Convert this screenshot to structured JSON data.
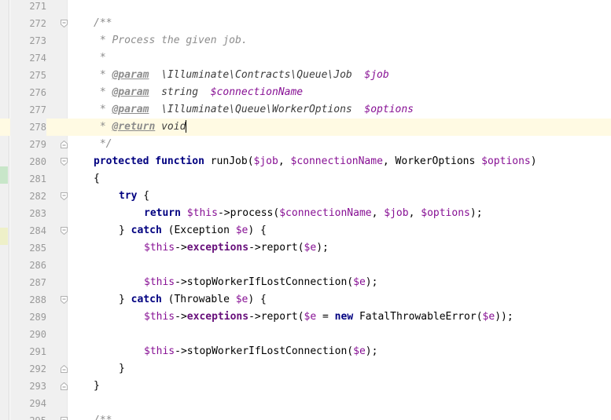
{
  "editor": {
    "current_line": 278,
    "lines": [
      {
        "n": "271",
        "indent": 1,
        "fold": "",
        "tokens": []
      },
      {
        "n": "272",
        "indent": 1,
        "fold": "open",
        "tokens": [
          {
            "t": "/**",
            "c": "doc"
          }
        ]
      },
      {
        "n": "273",
        "indent": 1,
        "fold": "",
        "tokens": [
          {
            "t": " * Process the given job.",
            "c": "doc"
          }
        ]
      },
      {
        "n": "274",
        "indent": 1,
        "fold": "",
        "tokens": [
          {
            "t": " *",
            "c": "doc"
          }
        ]
      },
      {
        "n": "275",
        "indent": 1,
        "fold": "",
        "tokens": [
          {
            "t": " * ",
            "c": "doc"
          },
          {
            "t": "@param",
            "c": "tag"
          },
          {
            "t": "  \\Illuminate\\Contracts\\Queue\\Job  ",
            "c": "dtype"
          },
          {
            "t": "$job",
            "c": "dvar"
          }
        ]
      },
      {
        "n": "276",
        "indent": 1,
        "fold": "",
        "tokens": [
          {
            "t": " * ",
            "c": "doc"
          },
          {
            "t": "@param",
            "c": "tag"
          },
          {
            "t": "  string  ",
            "c": "dtype"
          },
          {
            "t": "$connectionName",
            "c": "dvar"
          }
        ]
      },
      {
        "n": "277",
        "indent": 1,
        "fold": "",
        "tokens": [
          {
            "t": " * ",
            "c": "doc"
          },
          {
            "t": "@param",
            "c": "tag"
          },
          {
            "t": "  \\Illuminate\\Queue\\WorkerOptions  ",
            "c": "dtype"
          },
          {
            "t": "$options",
            "c": "dvar"
          }
        ]
      },
      {
        "n": "278",
        "indent": 1,
        "fold": "",
        "caret": true,
        "tokens": [
          {
            "t": " * ",
            "c": "doc"
          },
          {
            "t": "@return",
            "c": "tag"
          },
          {
            "t": " void",
            "c": "dtype"
          }
        ]
      },
      {
        "n": "279",
        "indent": 1,
        "fold": "close",
        "tokens": [
          {
            "t": " */",
            "c": "doc"
          }
        ]
      },
      {
        "n": "280",
        "indent": 1,
        "fold": "open",
        "tokens": [
          {
            "t": "protected",
            "c": "kw"
          },
          {
            "t": " ",
            "c": "plain"
          },
          {
            "t": "function",
            "c": "kw"
          },
          {
            "t": " runJob(",
            "c": "plain"
          },
          {
            "t": "$job",
            "c": "var"
          },
          {
            "t": ", ",
            "c": "plain"
          },
          {
            "t": "$connectionName",
            "c": "var"
          },
          {
            "t": ", WorkerOptions ",
            "c": "plain"
          },
          {
            "t": "$options",
            "c": "var"
          },
          {
            "t": ")",
            "c": "plain"
          }
        ]
      },
      {
        "n": "281",
        "indent": 1,
        "fold": "",
        "tokens": [
          {
            "t": "{",
            "c": "plain"
          }
        ]
      },
      {
        "n": "282",
        "indent": 2,
        "fold": "open",
        "tokens": [
          {
            "t": "try",
            "c": "kw"
          },
          {
            "t": " {",
            "c": "plain"
          }
        ]
      },
      {
        "n": "283",
        "indent": 3,
        "fold": "",
        "tokens": [
          {
            "t": "return",
            "c": "kw"
          },
          {
            "t": " ",
            "c": "plain"
          },
          {
            "t": "$this",
            "c": "var"
          },
          {
            "t": "->process(",
            "c": "plain"
          },
          {
            "t": "$connectionName",
            "c": "var"
          },
          {
            "t": ", ",
            "c": "plain"
          },
          {
            "t": "$job",
            "c": "var"
          },
          {
            "t": ", ",
            "c": "plain"
          },
          {
            "t": "$options",
            "c": "var"
          },
          {
            "t": ");",
            "c": "plain"
          }
        ]
      },
      {
        "n": "284",
        "indent": 2,
        "fold": "open",
        "tokens": [
          {
            "t": "} ",
            "c": "plain"
          },
          {
            "t": "catch",
            "c": "kw"
          },
          {
            "t": " (Exception ",
            "c": "plain"
          },
          {
            "t": "$e",
            "c": "var"
          },
          {
            "t": ") {",
            "c": "plain"
          }
        ]
      },
      {
        "n": "285",
        "indent": 3,
        "fold": "",
        "tokens": [
          {
            "t": "$this",
            "c": "var"
          },
          {
            "t": "->",
            "c": "plain"
          },
          {
            "t": "exceptions",
            "c": "prop"
          },
          {
            "t": "->report(",
            "c": "plain"
          },
          {
            "t": "$e",
            "c": "var"
          },
          {
            "t": ");",
            "c": "plain"
          }
        ]
      },
      {
        "n": "286",
        "indent": 3,
        "fold": "",
        "tokens": []
      },
      {
        "n": "287",
        "indent": 3,
        "fold": "",
        "tokens": [
          {
            "t": "$this",
            "c": "var"
          },
          {
            "t": "->stopWorkerIfLostConnection(",
            "c": "plain"
          },
          {
            "t": "$e",
            "c": "var"
          },
          {
            "t": ");",
            "c": "plain"
          }
        ]
      },
      {
        "n": "288",
        "indent": 2,
        "fold": "open",
        "tokens": [
          {
            "t": "} ",
            "c": "plain"
          },
          {
            "t": "catch",
            "c": "kw"
          },
          {
            "t": " (Throwable ",
            "c": "plain"
          },
          {
            "t": "$e",
            "c": "var"
          },
          {
            "t": ") {",
            "c": "plain"
          }
        ]
      },
      {
        "n": "289",
        "indent": 3,
        "fold": "",
        "tokens": [
          {
            "t": "$this",
            "c": "var"
          },
          {
            "t": "->",
            "c": "plain"
          },
          {
            "t": "exceptions",
            "c": "prop"
          },
          {
            "t": "->report(",
            "c": "plain"
          },
          {
            "t": "$e",
            "c": "var"
          },
          {
            "t": " = ",
            "c": "plain"
          },
          {
            "t": "new",
            "c": "kw"
          },
          {
            "t": " FatalThrowableError(",
            "c": "plain"
          },
          {
            "t": "$e",
            "c": "var"
          },
          {
            "t": "));",
            "c": "plain"
          }
        ]
      },
      {
        "n": "290",
        "indent": 3,
        "fold": "",
        "tokens": []
      },
      {
        "n": "291",
        "indent": 3,
        "fold": "",
        "tokens": [
          {
            "t": "$this",
            "c": "var"
          },
          {
            "t": "->stopWorkerIfLostConnection(",
            "c": "plain"
          },
          {
            "t": "$e",
            "c": "var"
          },
          {
            "t": ");",
            "c": "plain"
          }
        ]
      },
      {
        "n": "292",
        "indent": 2,
        "fold": "close",
        "tokens": [
          {
            "t": "}",
            "c": "plain"
          }
        ]
      },
      {
        "n": "293",
        "indent": 1,
        "fold": "close",
        "tokens": [
          {
            "t": "}",
            "c": "plain"
          }
        ]
      },
      {
        "n": "294",
        "indent": 1,
        "fold": "",
        "tokens": []
      },
      {
        "n": "295",
        "indent": 1,
        "fold": "open",
        "tokens": [
          {
            "t": "/**",
            "c": "doc"
          }
        ]
      }
    ]
  }
}
